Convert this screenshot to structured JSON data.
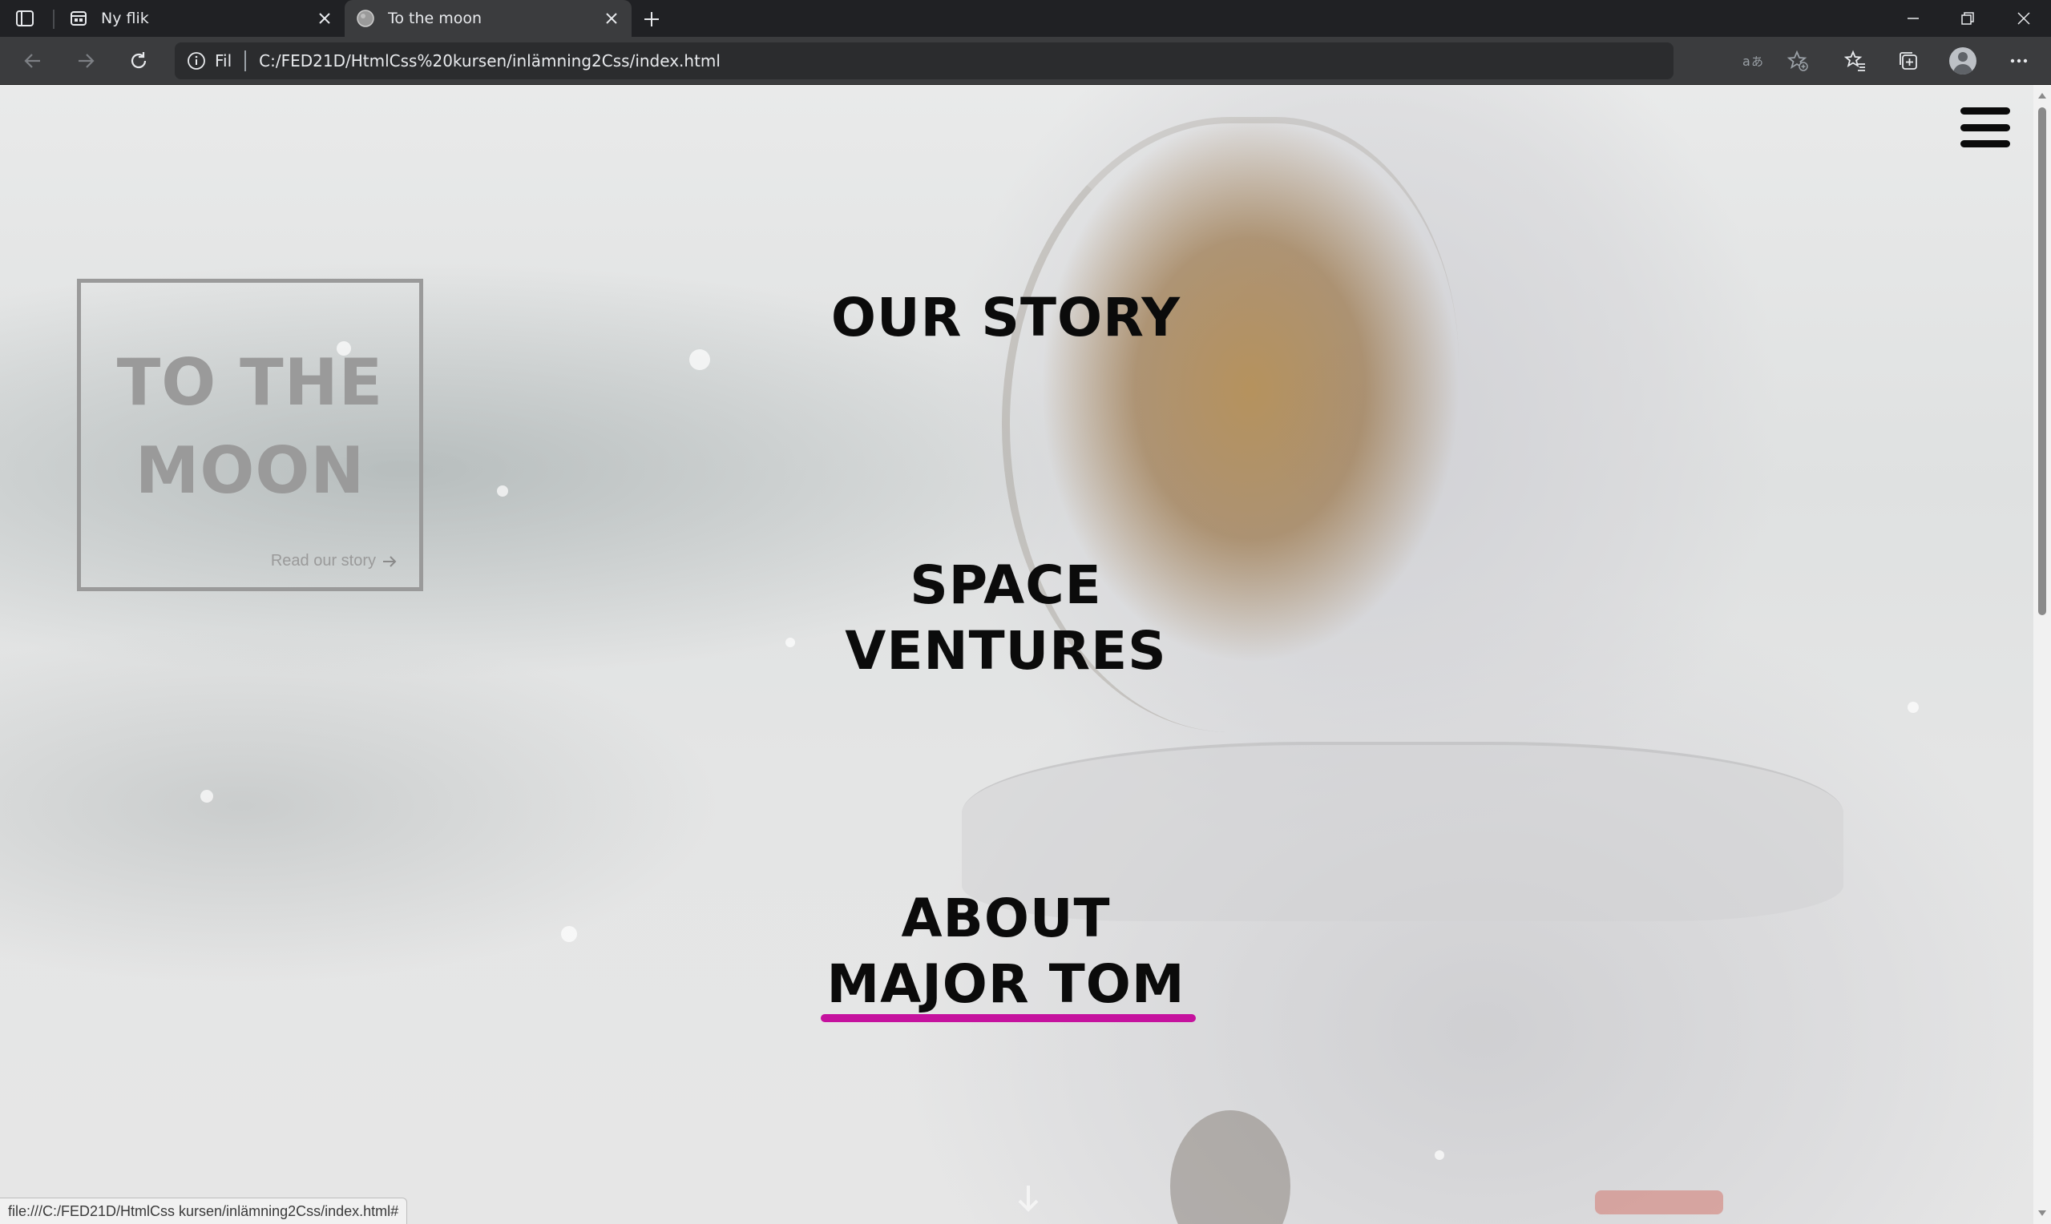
{
  "browser": {
    "tabs": [
      {
        "title": "Ny flik",
        "active": false,
        "favicon": "newtab-icon"
      },
      {
        "title": "To the moon",
        "active": true,
        "favicon": "globe-icon"
      }
    ],
    "address": {
      "scheme_label": "Fil",
      "url": "C:/FED21D/HtmlCss%20kursen/inlämning2Css/index.html"
    },
    "status_url": "file:///C:/FED21D/HtmlCss kursen/inlämning2Css/index.html#",
    "icons": [
      "sidebar-icon",
      "newtab-icon",
      "close-icon",
      "plus-icon",
      "minimize-icon",
      "restore-icon",
      "window-close-icon",
      "back-icon",
      "forward-icon",
      "reload-icon",
      "info-icon",
      "read-aloud-icon",
      "add-favorite-icon",
      "favorites-icon",
      "collections-icon",
      "profile-icon",
      "more-icon"
    ]
  },
  "page": {
    "brand": {
      "title": "TO THE MOON",
      "link_text": "Read our story"
    },
    "nav": [
      {
        "label": "OUR STORY",
        "active": false
      },
      {
        "label": "SPACE VENTURES",
        "active": false
      },
      {
        "label": "ABOUT MAJOR TOM",
        "active": true
      }
    ],
    "colors": {
      "accent_underline": "#c5129e",
      "nav_text": "#0b0b0b",
      "brand_text": "#9a9a9a",
      "browser_dark": "#202124",
      "toolbar": "#3b3c3e"
    }
  }
}
